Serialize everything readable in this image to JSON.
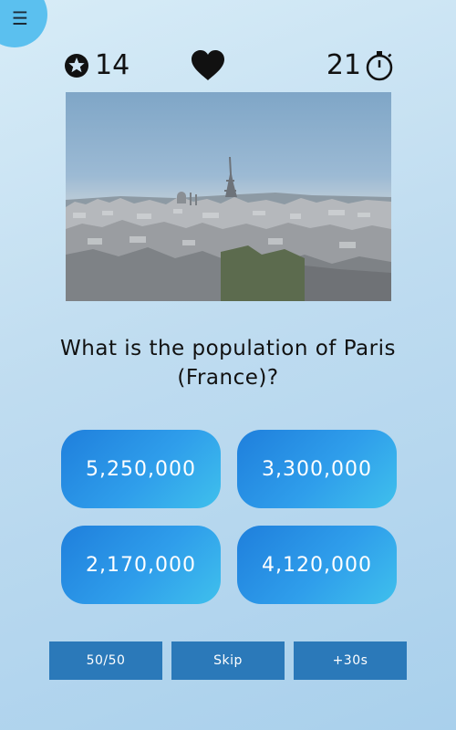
{
  "menu": {
    "icon": "hamburger-menu-icon",
    "glyph": "☰"
  },
  "hud": {
    "score_icon": "star-circle-icon",
    "score": "14",
    "lives_icon": "heart-icon",
    "timer": "21",
    "timer_icon": "stopwatch-icon"
  },
  "image": {
    "subject": "paris-cityscape-photo"
  },
  "question": "What is the population of Paris (France)?",
  "answers": [
    "5,250,000",
    "3,300,000",
    "2,170,000",
    "4,120,000"
  ],
  "powerups": [
    "50/50",
    "Skip",
    "+30s"
  ],
  "colors": {
    "answer_gradient_start": "#1f7fdc",
    "answer_gradient_end": "#3fc0ec",
    "powerup_bg": "#2b79b9",
    "menu_bg": "#5bc0ef"
  }
}
